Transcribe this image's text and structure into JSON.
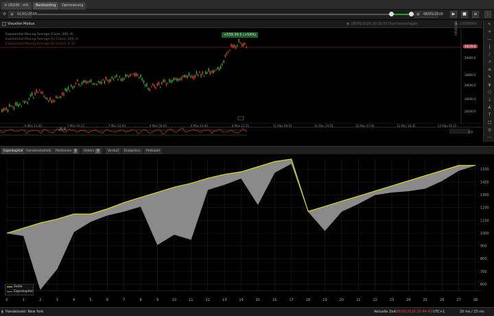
{
  "tabs": [
    {
      "label": "US100 · m5",
      "has_gear": true
    },
    {
      "label": "Backtesting"
    },
    {
      "label": "Optimierung"
    }
  ],
  "toolbar": {
    "start_date": "01/01/2026",
    "end_date": "08/05/2026"
  },
  "mode": {
    "label": "Visueller Modus",
    "timestamp": "08/05/2026 20:25:57",
    "status": "Durchzuschlagen",
    "speed": "1000000x"
  },
  "price_chart": {
    "indicators": [
      {
        "label": "Exponential Moving Average (Close, 200, 0)",
        "color": "#8a8a8a"
      },
      {
        "label": "Exponential Moving Average (C) (Close, 200, 0)",
        "color": "#7a6a6a"
      },
      {
        "label": "Exponential Moving Average (C) (Close, 0, 0)",
        "color": "#8a4040"
      }
    ],
    "profit_badge": "+539.39 € (+54%)",
    "price_tag": "29278.8",
    "price_axis_label": "29500.000",
    "price_ticks": [
      "29400.0",
      "29000.0",
      "28800.0",
      "28600.0",
      "28400.0",
      "28200.0"
    ],
    "time_ticks": [
      "6 May 13:30",
      "7 May 01:15",
      "7 May 12:00",
      "8 May 00:00",
      "8 May 10:40",
      "8 May 21:35",
      "11 May 09:15",
      "11 May 19:55",
      "12 May 07:00",
      "12 May 18:30",
      "13 May 06:15"
    ],
    "oscillator_value": "25.0",
    "oscillator_axis": "0.0"
  },
  "bottom_tabs": [
    {
      "label": "Eigenkapital",
      "active": true
    },
    {
      "label": "Handelsstatistik"
    },
    {
      "label": "Positionen",
      "badge": "0"
    },
    {
      "label": "Orders",
      "badge": "0"
    },
    {
      "label": "Verlauf"
    },
    {
      "label": "Ereignisse"
    },
    {
      "label": "Protokoll"
    }
  ],
  "chart_data": {
    "type": "area",
    "x": [
      0,
      1,
      2,
      3,
      4,
      5,
      6,
      7,
      8,
      9,
      10,
      11,
      12,
      13,
      14,
      15,
      16,
      17,
      18,
      19,
      20,
      21,
      22,
      23,
      24,
      25,
      26,
      27,
      28
    ],
    "series": [
      {
        "name": "Saldo",
        "color": "#e6e600",
        "values": [
          1000,
          1040,
          1080,
          1110,
          1150,
          1150,
          1190,
          1240,
          1280,
          1320,
          1360,
          1390,
          1430,
          1460,
          1480,
          1520,
          1560,
          1580,
          1170,
          1210,
          1250,
          1290,
          1330,
          1370,
          1410,
          1450,
          1490,
          1530,
          1530
        ]
      },
      {
        "name": "Eigenkapital",
        "color": "#888888",
        "values": [
          1000,
          980,
          560,
          720,
          1010,
          1090,
          1140,
          1170,
          1210,
          910,
          990,
          950,
          1340,
          1380,
          1430,
          1225,
          1475,
          1545,
          1170,
          1020,
          1170,
          1230,
          1300,
          1320,
          1330,
          1350,
          1410,
          1490,
          1530
        ]
      }
    ],
    "y_ticks": [
      600,
      700,
      800,
      900,
      1000,
      1100,
      1200,
      1300,
      1400,
      1500
    ],
    "ylim": [
      550,
      1580
    ],
    "xlim": [
      0,
      28
    ],
    "legend": "bottom-left",
    "grid": true
  },
  "status": {
    "market": "Handelszeit: New York",
    "current_time_label": "Aktuelle Zeit:",
    "current_time": "08/05/2026 20:44:43",
    "utc": "UTC+1",
    "latency": "20 ms / 25 ms"
  }
}
